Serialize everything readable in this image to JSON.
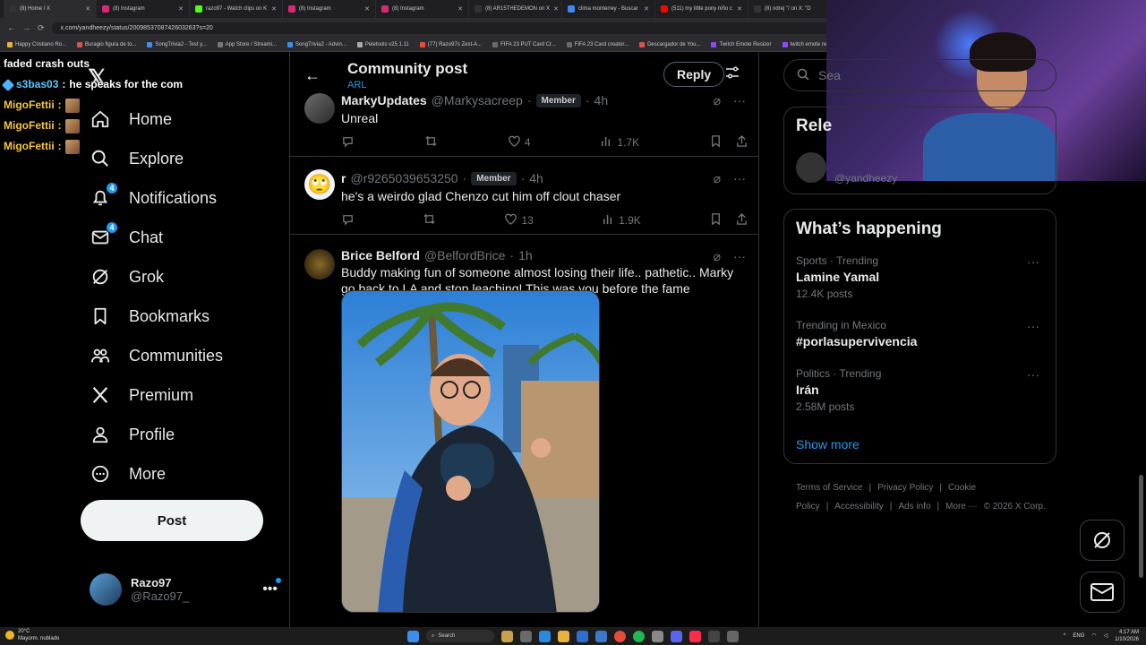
{
  "browser": {
    "tabs": [
      {
        "label": "(8) Home / X",
        "color": "#333"
      },
      {
        "label": "(8) Instagram",
        "color": "#d62976"
      },
      {
        "label": "razo97 - Watch clips on K",
        "color": "#53fc18"
      },
      {
        "label": "(8) Instagram",
        "color": "#d62976"
      },
      {
        "label": "(8) Instagram",
        "color": "#d62976"
      },
      {
        "label": "(8) AR15THEDEMON on X",
        "color": "#333"
      },
      {
        "label": "clima monterrey - Buscar",
        "color": "#4285f4"
      },
      {
        "label": "(511) my little pony niño c",
        "color": "#ff0000"
      },
      {
        "label": "(8) ndrej \"/ on X: \"D",
        "color": "#333"
      }
    ],
    "url": "x.com/yandheezy/status/2009853708742603263?s=20",
    "bookmarks": [
      "Happy Cristiano Ro...",
      "Buragio figura de to...",
      "SongTrivia2 - Test y...",
      "App Store / Streami...",
      "SongTrivia2 - Advin...",
      "Peletools v25.1.11",
      "(77) Razo97s Zest-A...",
      "FIFA 23 PUT Card Cr...",
      "FIFA 23 Card creator...",
      "Descargador de You...",
      "Twitch Emote Resizer",
      "twitch emote resiz"
    ]
  },
  "stream_chat": [
    {
      "user": "",
      "message": "faded crash outs",
      "style": "plain"
    },
    {
      "user": "s3bas03",
      "message": "he speaks for the com",
      "style": "teal"
    },
    {
      "user": "MigoFettii",
      "message": "",
      "style": "gold"
    },
    {
      "user": "MigoFettii",
      "message": "",
      "style": "gold"
    },
    {
      "user": "MigoFettii",
      "message": "",
      "style": "gold"
    }
  ],
  "chat_sep": ":",
  "nav": {
    "items": [
      {
        "label": "Home",
        "icon": "home-icon"
      },
      {
        "label": "Explore",
        "icon": "search-icon"
      },
      {
        "label": "Notifications",
        "icon": "bell-icon",
        "badge": "4"
      },
      {
        "label": "Chat",
        "icon": "mail-icon",
        "badge": "4"
      },
      {
        "label": "Grok",
        "icon": "grok-icon"
      },
      {
        "label": "Bookmarks",
        "icon": "bookmark-icon"
      },
      {
        "label": "Communities",
        "icon": "communities-icon"
      },
      {
        "label": "Premium",
        "icon": "x-logo-icon"
      },
      {
        "label": "Profile",
        "icon": "profile-icon"
      },
      {
        "label": "More",
        "icon": "more-circle-icon"
      }
    ],
    "post_label": "Post",
    "account": {
      "name": "Razo97",
      "handle": "@Razo97_",
      "more": "•••"
    }
  },
  "header": {
    "title": "Community post",
    "subtitle": "ARL",
    "reply_label": "Reply"
  },
  "tweets": [
    {
      "name": "MarkyUpdates",
      "handle": "@Markysacreep",
      "badge": "Member",
      "dot": "·",
      "time": "4h",
      "text": "Unreal",
      "replies": "",
      "retweets": "",
      "likes": "4",
      "views": "1.7K"
    },
    {
      "name": "r",
      "handle": "@r9265039653250",
      "badge": "Member",
      "dot": "·",
      "time": "4h",
      "text": "he's a weirdo glad Chenzo cut him off clout chaser",
      "replies": "",
      "retweets": "",
      "likes": "13",
      "views": "1.9K"
    },
    {
      "name": "Brice Belford",
      "handle": "@BelfordBrice",
      "badge": "",
      "dot": "·",
      "time": "1h",
      "text": "Buddy making fun of someone almost losing their life.. pathetic.. Marky go back to LA and stop leaching! This was you before the fame"
    }
  ],
  "right": {
    "search_placeholder": "Sea",
    "relevant_title": "Rele",
    "relevant_handle": "@yandheezy",
    "happening_title": "What’s happening",
    "trends": [
      {
        "meta": "Sports · Trending",
        "name": "Lamine Yamal",
        "count": "12.4K posts"
      },
      {
        "meta": "Trending in Mexico",
        "name": "#porlasupervivencia",
        "count": ""
      },
      {
        "meta": "Politics · Trending",
        "name": "Irán",
        "count": "2.58M posts"
      }
    ],
    "show_more": "Show more",
    "footer": [
      "Terms of Service",
      "|",
      "Privacy Policy",
      "|",
      "Cookie Policy",
      "|",
      "Accessibility",
      "|",
      "Ads info",
      "|",
      "More ···",
      "© 2026 X Corp."
    ]
  },
  "taskbar": {
    "temp": "20°C",
    "weather": "Mayorm. nublado",
    "search": "Search",
    "lang": "ENG",
    "time": "4:17 AM",
    "date": "1/10/2026"
  },
  "colors": {
    "accent": "#1d9bf0",
    "background": "#000000",
    "border": "#2f3336"
  }
}
